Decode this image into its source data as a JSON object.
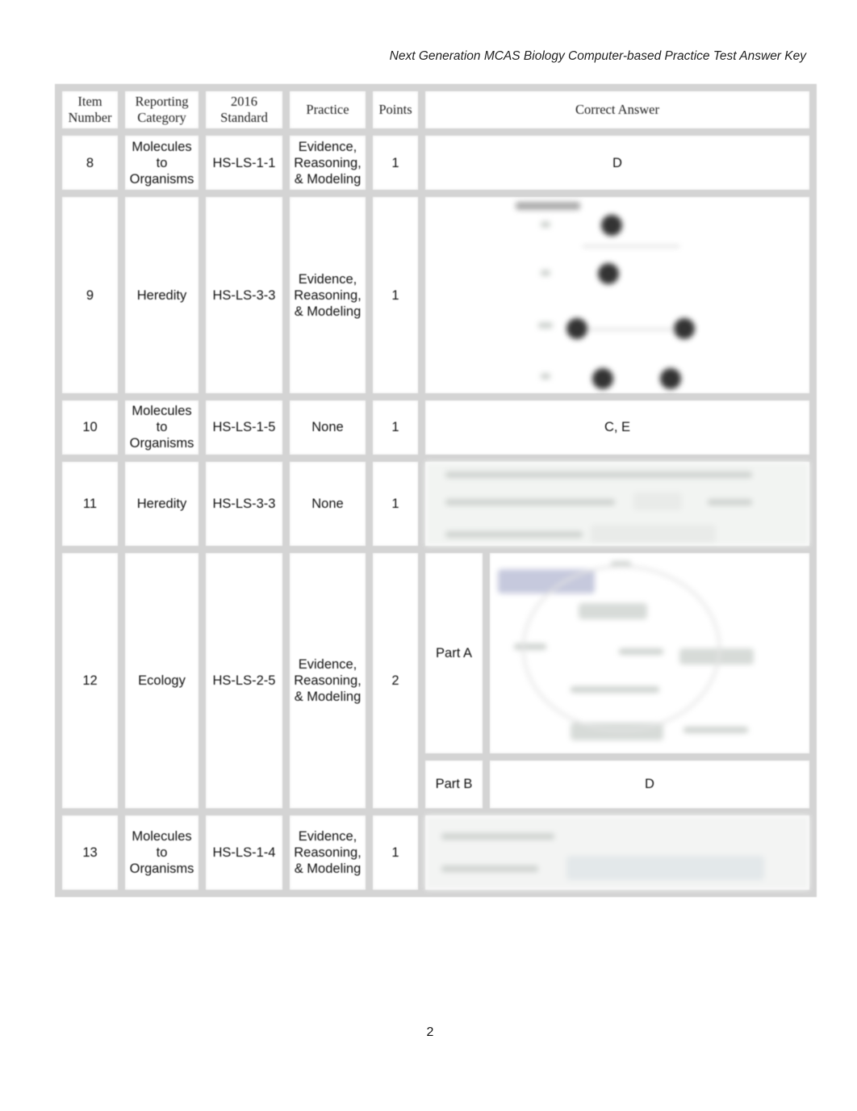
{
  "document": {
    "running_header": "Next Generation MCAS Biology Computer-based Practice Test Answer Key",
    "page_number": "2"
  },
  "table": {
    "headers": {
      "item_number": "Item\nNumber",
      "reporting_category": "Reporting\nCategory",
      "standard": "2016\nStandard",
      "practice": "Practice",
      "points": "Points",
      "correct_answer": "Correct Answer"
    },
    "rows": [
      {
        "item": "8",
        "category": "Molecules to Organisms",
        "standard": "HS-LS-1-1",
        "practice": "Evidence, Reasoning, & Modeling",
        "points": "1",
        "answer": "D",
        "answer_type": "text"
      },
      {
        "item": "9",
        "category": "Heredity",
        "standard": "HS-LS-3-3",
        "practice": "Evidence, Reasoning, & Modeling",
        "points": "1",
        "answer_type": "image",
        "answer_image": "pedigree-chart (illegible)"
      },
      {
        "item": "10",
        "category": "Molecules to Organisms",
        "standard": "HS-LS-1-5",
        "practice": "None",
        "points": "1",
        "answer": "C, E",
        "answer_type": "text"
      },
      {
        "item": "11",
        "category": "Heredity",
        "standard": "HS-LS-3-3",
        "practice": "None",
        "points": "1",
        "answer_type": "image",
        "answer_image": "dropdown-sentence (illegible)"
      },
      {
        "item": "12",
        "category": "Ecology",
        "standard": "HS-LS-2-5",
        "practice": "Evidence, Reasoning, & Modeling",
        "points": "2",
        "answer_type": "parts",
        "parts": [
          {
            "label": "Part A",
            "answer_type": "image",
            "answer_image": "cycle-diagram (illegible)"
          },
          {
            "label": "Part B",
            "answer": "D",
            "answer_type": "text"
          }
        ]
      },
      {
        "item": "13",
        "category": "Molecules to Organisms",
        "standard": "HS-LS-1-4",
        "practice": "Evidence, Reasoning, & Modeling",
        "points": "1",
        "answer_type": "image",
        "answer_image": "mrna-codon-table (illegible)"
      }
    ]
  }
}
